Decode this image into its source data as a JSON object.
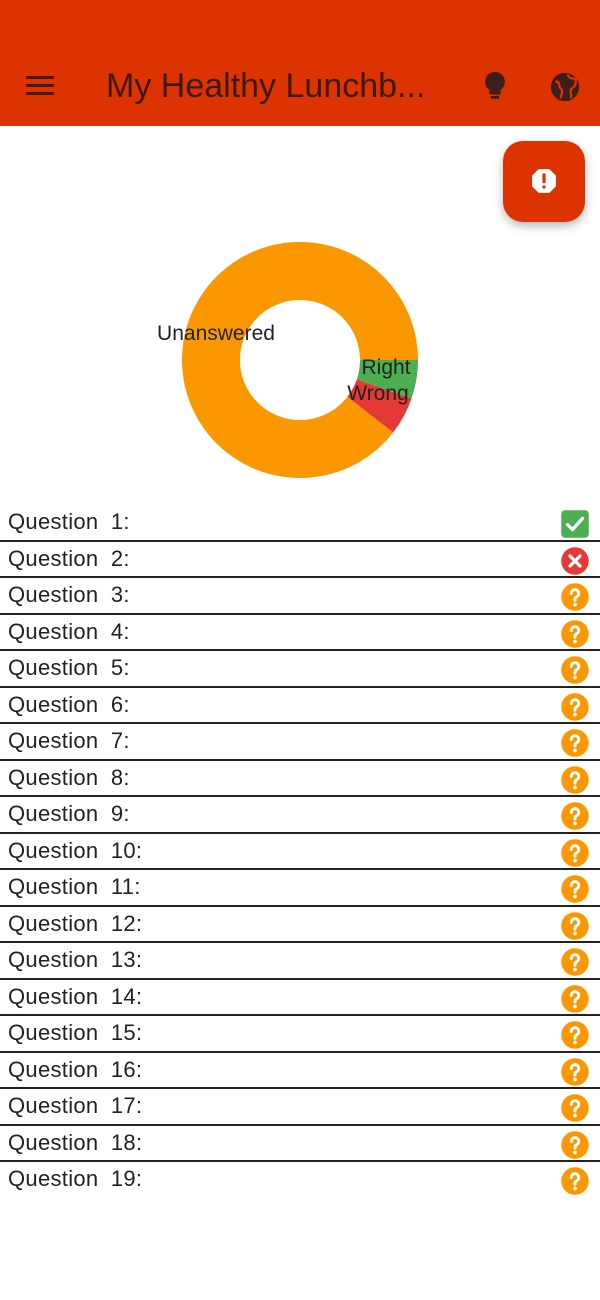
{
  "app_bar": {
    "title": "My Healthy Lunchb...",
    "menu_icon": "menu-icon",
    "actions": [
      "lightbulb-icon",
      "globe-icon"
    ],
    "background": "#dd3300"
  },
  "fab": {
    "icon": "alert-octagon-icon",
    "background": "#dd3300"
  },
  "chart_data": {
    "type": "pie",
    "donut": true,
    "slices": [
      {
        "label": "Unanswered",
        "value": 17,
        "color": "#fb9700"
      },
      {
        "label": "Right",
        "value": 1,
        "color": "#4caf50"
      },
      {
        "label": "Wrong",
        "value": 1,
        "color": "#e53935"
      }
    ]
  },
  "questions": [
    {
      "label": "Question 1:",
      "status": "right"
    },
    {
      "label": "Question 2:",
      "status": "wrong"
    },
    {
      "label": "Question 3:",
      "status": "unanswered"
    },
    {
      "label": "Question 4:",
      "status": "unanswered"
    },
    {
      "label": "Question 5:",
      "status": "unanswered"
    },
    {
      "label": "Question 6:",
      "status": "unanswered"
    },
    {
      "label": "Question 7:",
      "status": "unanswered"
    },
    {
      "label": "Question 8:",
      "status": "unanswered"
    },
    {
      "label": "Question 9:",
      "status": "unanswered"
    },
    {
      "label": "Question 10:",
      "status": "unanswered"
    },
    {
      "label": "Question 11:",
      "status": "unanswered"
    },
    {
      "label": "Question 12:",
      "status": "unanswered"
    },
    {
      "label": "Question 13:",
      "status": "unanswered"
    },
    {
      "label": "Question 14:",
      "status": "unanswered"
    },
    {
      "label": "Question 15:",
      "status": "unanswered"
    },
    {
      "label": "Question 16:",
      "status": "unanswered"
    },
    {
      "label": "Question 17:",
      "status": "unanswered"
    },
    {
      "label": "Question 18:",
      "status": "unanswered"
    },
    {
      "label": "Question 19:",
      "status": "unanswered"
    }
  ],
  "status_icons": {
    "right": "check-box-icon",
    "wrong": "cancel-circle-icon",
    "unanswered": "help-circle-icon"
  },
  "status_colors": {
    "right": "#4caf50",
    "wrong": "#e53935",
    "unanswered": "#fb9700"
  }
}
